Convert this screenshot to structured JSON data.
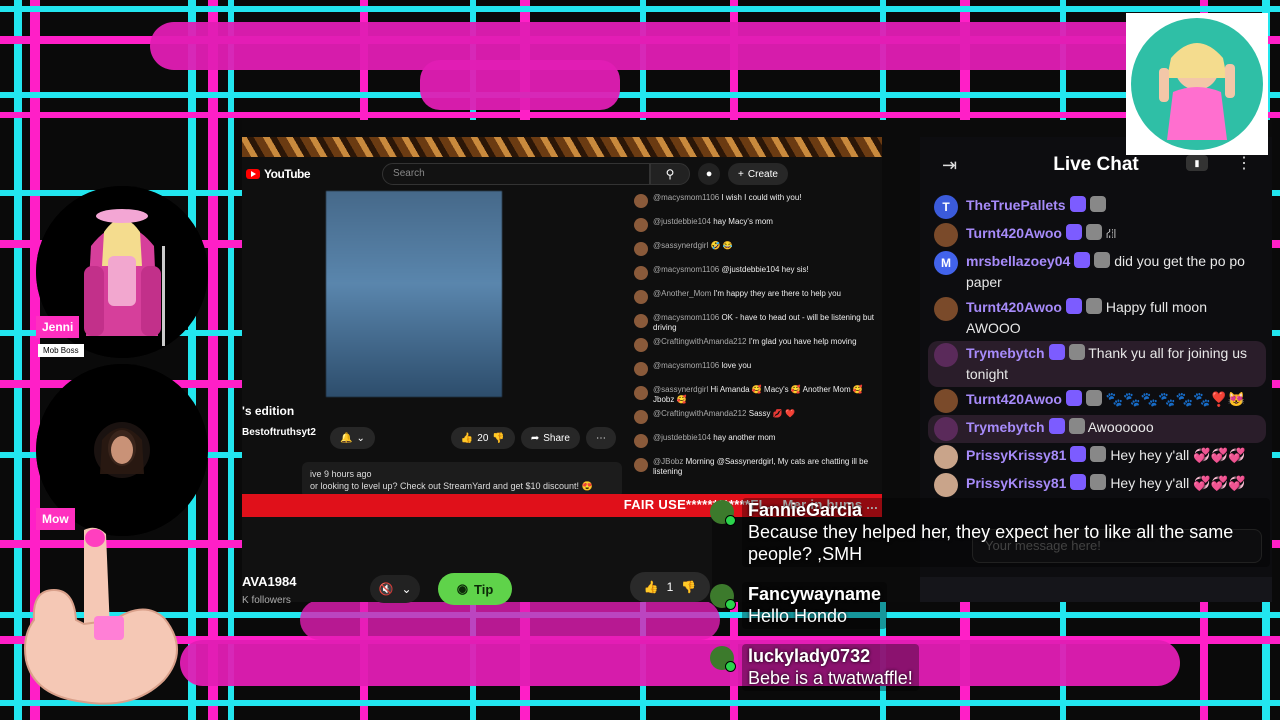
{
  "youtube": {
    "logo": "YouTube",
    "search_placeholder": "Search",
    "create_label": "Create",
    "video_title_fragment": "'s edition",
    "channel_fragment": "Bestoftruthsyt2",
    "like_count": "20",
    "share_label": "Share",
    "desc_line1": "ive 9 hours ago",
    "desc_line2": "or looking to level up? Check out StreamYard and get $10 discount! 😍",
    "fair_use": "FAIR USE************FL... Mer in bums ...",
    "chat": [
      {
        "name": "@macysmom1106",
        "text": "I wish I could with you!"
      },
      {
        "name": "@justdebbie104",
        "text": "hay Macy's mom"
      },
      {
        "name": "@sassynerdgirl",
        "text": "🤣 😂"
      },
      {
        "name": "@macysmom1106",
        "text": "@justdebbie104 hey sis!"
      },
      {
        "name": "@Another_Mom",
        "text": "I'm happy they are there to help you"
      },
      {
        "name": "@macysmom1106",
        "text": "OK - have to head out - will be listening but driving"
      },
      {
        "name": "@CraftingwithAmanda212",
        "text": "I'm glad you have help moving"
      },
      {
        "name": "@macysmom1106",
        "text": "love you"
      },
      {
        "name": "@sassynerdgirl",
        "text": "Hi Amanda 🥰 Macy's 🥰 Another Mom 🥰 Jbobz 🥰"
      },
      {
        "name": "@CraftingwithAmanda212",
        "text": "Sassy 💋 ❤️"
      },
      {
        "name": "@justdebbie104",
        "text": "hay another mom"
      },
      {
        "name": "@JBobz",
        "text": "Morning @Sassynerdgirl, My cats are chatting ill be listening"
      }
    ]
  },
  "bottom_strip": {
    "name": "AVA1984",
    "followers": "K followers",
    "tip_label": "Tip",
    "like_count": "1"
  },
  "live_chat": {
    "title": "Live Chat",
    "input_placeholder": "Your message here!",
    "messages": [
      {
        "name": "TheTruePallets",
        "text": "",
        "avatar": "T",
        "color": "#3b5bdb"
      },
      {
        "name": "Turnt420Awoo",
        "text": "⛜",
        "avatar": "",
        "color": "#7a4a2a"
      },
      {
        "name": "mrsbellazoey04",
        "text": "did you get the po po paper",
        "avatar": "M",
        "color": "#4263eb"
      },
      {
        "name": "Turnt420Awoo",
        "text": "Happy full moon AWOOO",
        "avatar": "",
        "color": "#7a4a2a"
      },
      {
        "name": "Trymebytch",
        "text": "Thank yu all for joining us tonight",
        "avatar": "",
        "color": "#5a2a5a"
      },
      {
        "name": "Turnt420Awoo",
        "text": "🐾🐾🐾🐾🐾🐾❣️😻",
        "avatar": "",
        "color": "#7a4a2a"
      },
      {
        "name": "Trymebytch",
        "text": "Awoooooo",
        "avatar": "",
        "color": "#5a2a5a"
      },
      {
        "name": "PrissyKrissy81",
        "text": "Hey hey y'all 💞💞💞",
        "avatar": "",
        "color": "#c9a48a"
      },
      {
        "name": "PrissyKrissy81",
        "text": "Hey hey y'all 💞💞💞",
        "avatar": "",
        "color": "#c9a48a"
      }
    ]
  },
  "overlay_chat": [
    {
      "name": "FannieGarcia",
      "text": "Because they helped her, they expect her to like all the same people? ,SMH"
    },
    {
      "name": "Fancywayname",
      "text": "Hello Hondo"
    },
    {
      "name": "luckylady0732",
      "text": "Bebe is a twatwaffle!"
    }
  ],
  "hosts": [
    {
      "label": "Jenni",
      "sub": "Mob Boss"
    },
    {
      "label": "Mow",
      "sub": ""
    }
  ],
  "colors": {
    "accent_pink": "#ff1fc7",
    "accent_cyan": "#22e6ef",
    "fair_use_red": "#e0101a",
    "tip_green": "#5fd34a"
  }
}
